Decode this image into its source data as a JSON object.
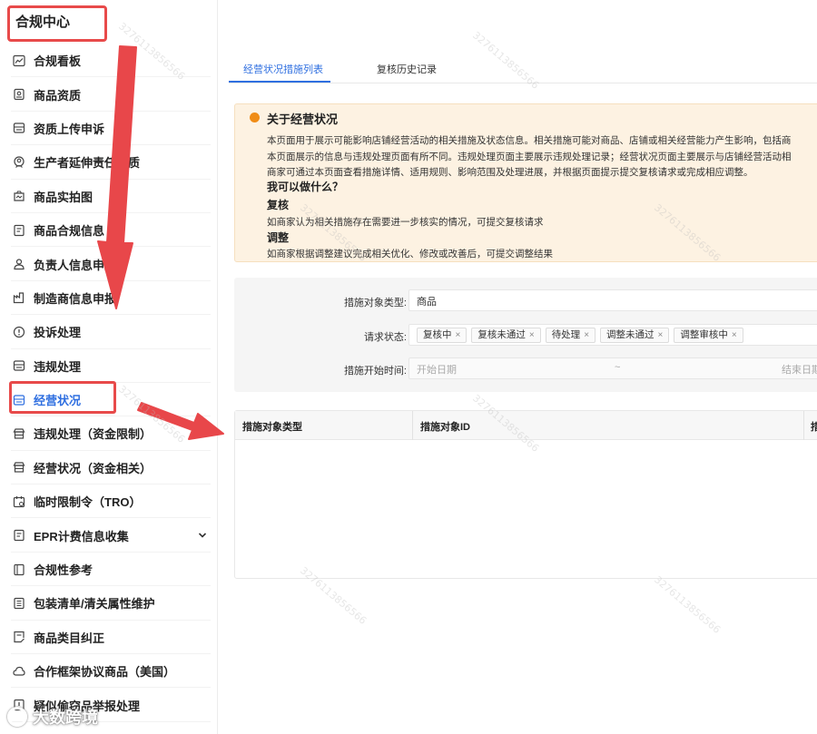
{
  "sidebar": {
    "title": "合规中心",
    "items": [
      {
        "label": "合规看板",
        "icon": "chart-icon"
      },
      {
        "label": "商品资质",
        "icon": "badge-icon"
      },
      {
        "label": "资质上传申诉",
        "icon": "folder-icon"
      },
      {
        "label": "生产者延伸责任资质",
        "icon": "gear-person-icon"
      },
      {
        "label": "商品实拍图",
        "icon": "photo-icon"
      },
      {
        "label": "商品合规信息",
        "icon": "document-icon"
      },
      {
        "label": "负责人信息申报",
        "icon": "person-icon"
      },
      {
        "label": "制造商信息申报",
        "icon": "factory-icon"
      },
      {
        "label": "投诉处理",
        "icon": "alert-icon"
      },
      {
        "label": "违规处理",
        "icon": "folder-icon"
      },
      {
        "label": "经营状况",
        "icon": "folder-icon"
      },
      {
        "label": "违规处理（资金限制）",
        "icon": "store-icon"
      },
      {
        "label": "经营状况（资金相关）",
        "icon": "store-icon"
      },
      {
        "label": "临时限制令（TRO）",
        "icon": "calendar-icon"
      },
      {
        "label": "EPR计费信息收集",
        "icon": "document-icon"
      },
      {
        "label": "合规性参考",
        "icon": "book-icon"
      },
      {
        "label": "包装清单/清关属性维护",
        "icon": "list-icon"
      },
      {
        "label": "商品类目纠正",
        "icon": "edit-doc-icon"
      },
      {
        "label": "合作框架协议商品（美国）",
        "icon": "cloud-icon"
      },
      {
        "label": "疑似偷窃品举报处理",
        "icon": "report-icon"
      }
    ],
    "active_index": 10
  },
  "tabs": [
    "经营状况措施列表",
    "复核历史记录"
  ],
  "notice": {
    "title": "关于经营状况",
    "lines": [
      "本页面用于展示可能影响店铺经营活动的相关措施及状态信息。相关措施可能对商品、店铺或相关经营能力产生影响，包括商",
      "本页面展示的信息与违规处理页面有所不同。违规处理页面主要展示违规处理记录；经营状况页面主要展示与店铺经营活动相",
      "商家可通过本页面查看措施详情、适用规则、影响范围及处理进展，并根据页面提示提交复核请求或完成相应调整。"
    ],
    "what_title": "我可以做什么？",
    "review_title": "复核",
    "review_text": "如商家认为相关措施存在需要进一步核实的情况，可提交复核请求",
    "adjust_title": "调整",
    "adjust_text": "如商家根据调整建议完成相关优化、修改或改善后，可提交调整结果"
  },
  "filters": {
    "object_type_label": "措施对象类型:",
    "object_type_value": "商品",
    "status_label": "请求状态:",
    "status_tags": [
      "复核中",
      "复核未通过",
      "待处理",
      "调整未通过",
      "调整审核中"
    ],
    "start_time_label": "措施开始时间:",
    "start_placeholder": "开始日期",
    "range_sep": "~",
    "end_placeholder": "结束日期"
  },
  "table": {
    "columns": [
      "措施对象类型",
      "措施对象ID",
      "措"
    ]
  },
  "watermark": {
    "repeat_text": "3276113856566",
    "brand": "大数跨境"
  },
  "colors": {
    "accent": "#2f6fe0",
    "annotation_red": "#e84a4a",
    "notice_bg": "#fdf2e2",
    "notice_dot": "#f08c16"
  }
}
